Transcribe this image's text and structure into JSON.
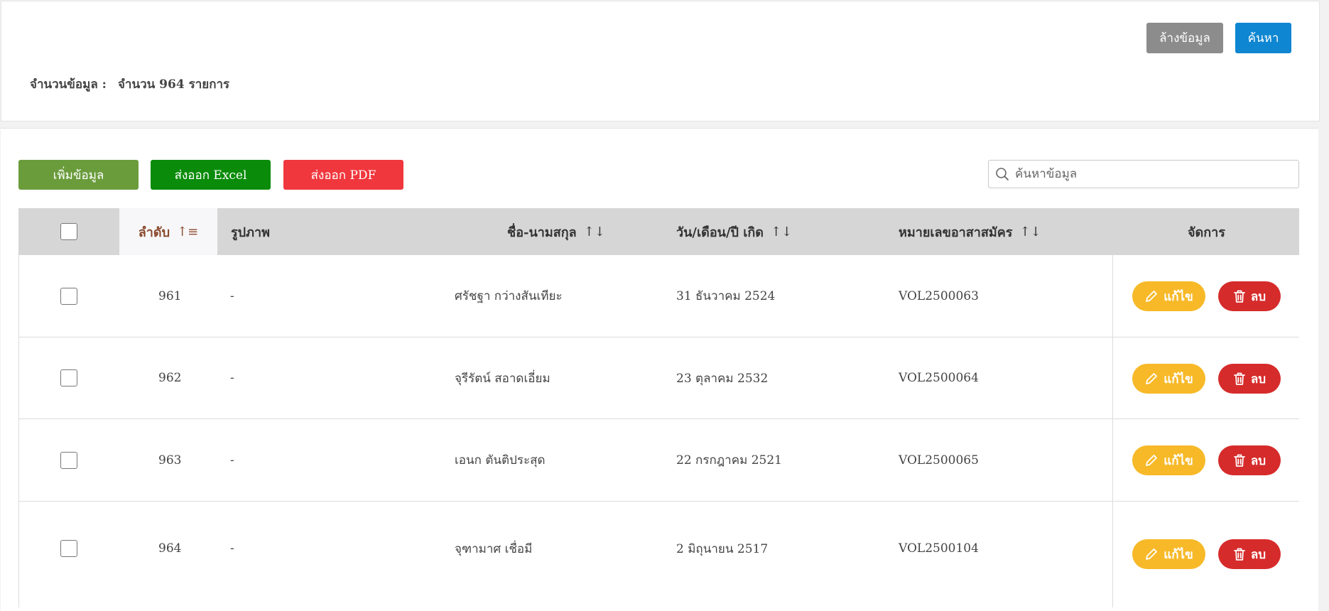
{
  "top_panel": {
    "clear_label": "ล้างข้อมูล",
    "search_label": "ค้นหา",
    "count_label": "จำนวนข้อมูล :",
    "count_value": "จำนวน 964 รายการ"
  },
  "toolbar": {
    "add_label": "เพิ่มข้อมูล",
    "excel_label": "ส่งออก Excel",
    "pdf_label": "ส่งออก PDF",
    "search_placeholder": "ค้นหาข้อมูล",
    "search_icon": "search-icon"
  },
  "table": {
    "headers": {
      "seq": "ลำดับ",
      "image": "รูปภาพ",
      "name": "ชื่อ-นามสกุล",
      "dob": "วัน/เดือน/ปี เกิด",
      "volunteer_id": "หมายเลขอาสาสมัคร",
      "actions": "จัดการ"
    },
    "rows": [
      {
        "seq": "961",
        "image": "-",
        "name": "ศรัชฐา กว่างสันเทียะ",
        "dob": "31 ธันวาคม 2524",
        "volunteer_id": "VOL2500063",
        "edit": "แก้ไข",
        "delete": "ลบ"
      },
      {
        "seq": "962",
        "image": "-",
        "name": "จุรีรัตน์ สอาดเอี่ยม",
        "dob": "23 ตุลาคม 2532",
        "volunteer_id": "VOL2500064",
        "edit": "แก้ไข",
        "delete": "ลบ"
      },
      {
        "seq": "963",
        "image": "-",
        "name": "เอนก ตันติประสุด",
        "dob": "22 กรกฎาคม 2521",
        "volunteer_id": "VOL2500065",
        "edit": "แก้ไข",
        "delete": "ลบ"
      },
      {
        "seq": "964",
        "image": "-",
        "name": "จุฑามาศ เชื่อมี",
        "dob": "2 มิถุนายน 2517",
        "volunteer_id": "VOL2500104",
        "edit": "แก้ไข",
        "delete": "ลบ"
      }
    ]
  },
  "colors": {
    "primary": "#0f86d1",
    "add": "#6a9c3c",
    "excel": "#0a8c0a",
    "pdf": "#f0373d",
    "edit": "#f7b928",
    "delete": "#d62b2b"
  }
}
